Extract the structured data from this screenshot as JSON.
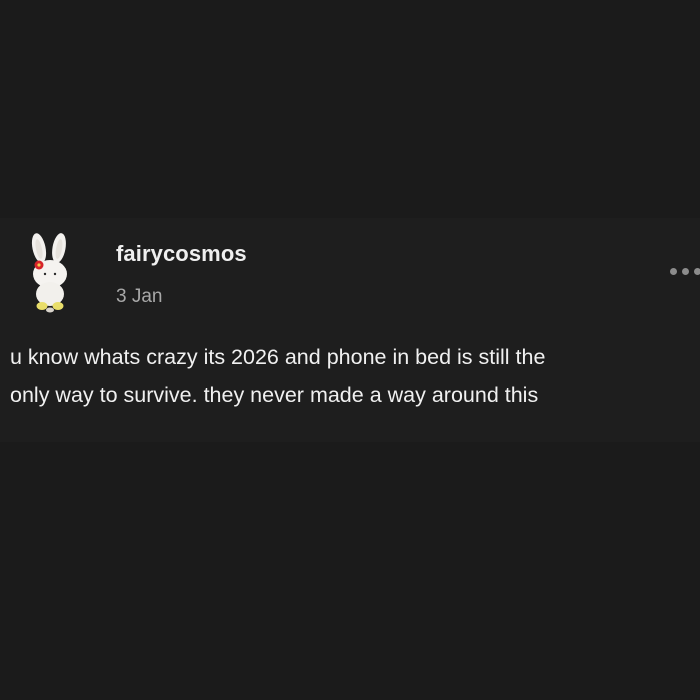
{
  "post": {
    "username": "fairycosmos",
    "date": "3 Jan",
    "body_lines": [
      "u know whats crazy its 2026 and phone in bed is still the",
      "only way to survive. they never made a way around this"
    ],
    "avatar_icon": "bunny-figurine-icon",
    "more_icon": "more-options-icon"
  },
  "colors": {
    "background": "#1b1b1b",
    "card": "#1e1e1e",
    "text_primary": "#f0f0f0",
    "text_secondary": "#a8a8a8"
  }
}
